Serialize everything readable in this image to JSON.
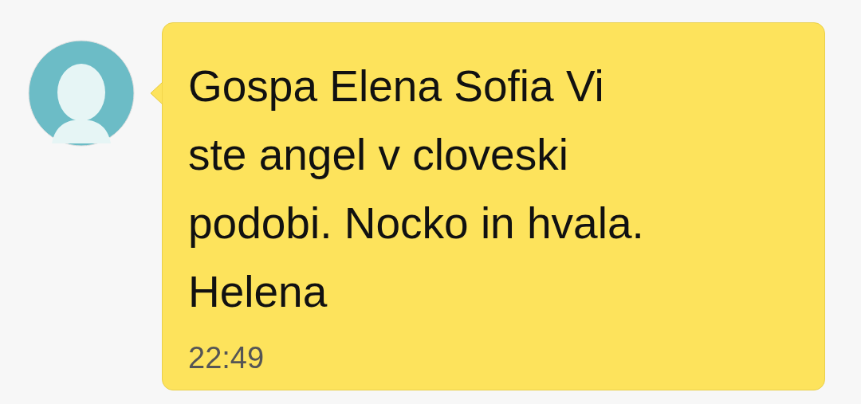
{
  "message": {
    "lines": [
      "Gospa Elena Sofia Vi",
      "ste angel v cloveski",
      "podobi. Nocko in hvala.",
      "Helena"
    ],
    "time": "22:49"
  }
}
